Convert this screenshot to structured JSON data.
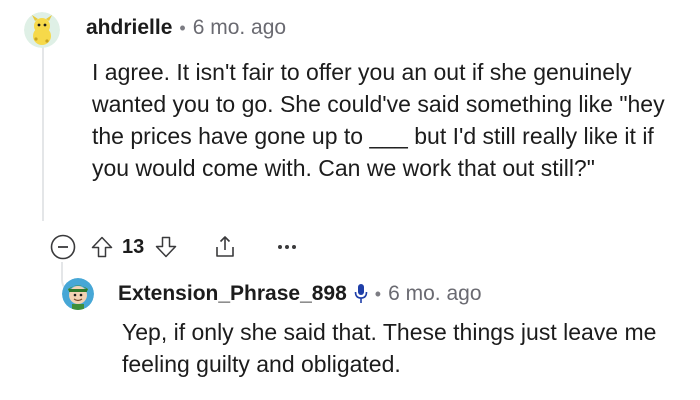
{
  "comment": {
    "username": "ahdrielle",
    "separator": "•",
    "time": "6 mo. ago",
    "body": "I agree. It isn't fair to offer you an out if she genuinely wanted you to go. She could've said something like \"hey the prices have gone up to ___ but I'd still really like it if you would come with. Can we work that out still?\"",
    "votes": "13",
    "icons": [
      "collapse-icon",
      "upvote-icon",
      "downvote-icon",
      "share-icon",
      "more-icon"
    ]
  },
  "reply": {
    "username": "Extension_Phrase_898",
    "separator": "•",
    "time": "6 mo. ago",
    "body": "Yep, if only she said that. These things just leave me feeling guilty and obligated.",
    "icons": [
      "microphone-icon"
    ]
  },
  "colors": {
    "text": "#1c1c1c",
    "muted": "#6a6a71",
    "thread_line": "#e4e6e8",
    "icon": "#3a3a3c",
    "avatar2_bg": "#47a7d6"
  }
}
